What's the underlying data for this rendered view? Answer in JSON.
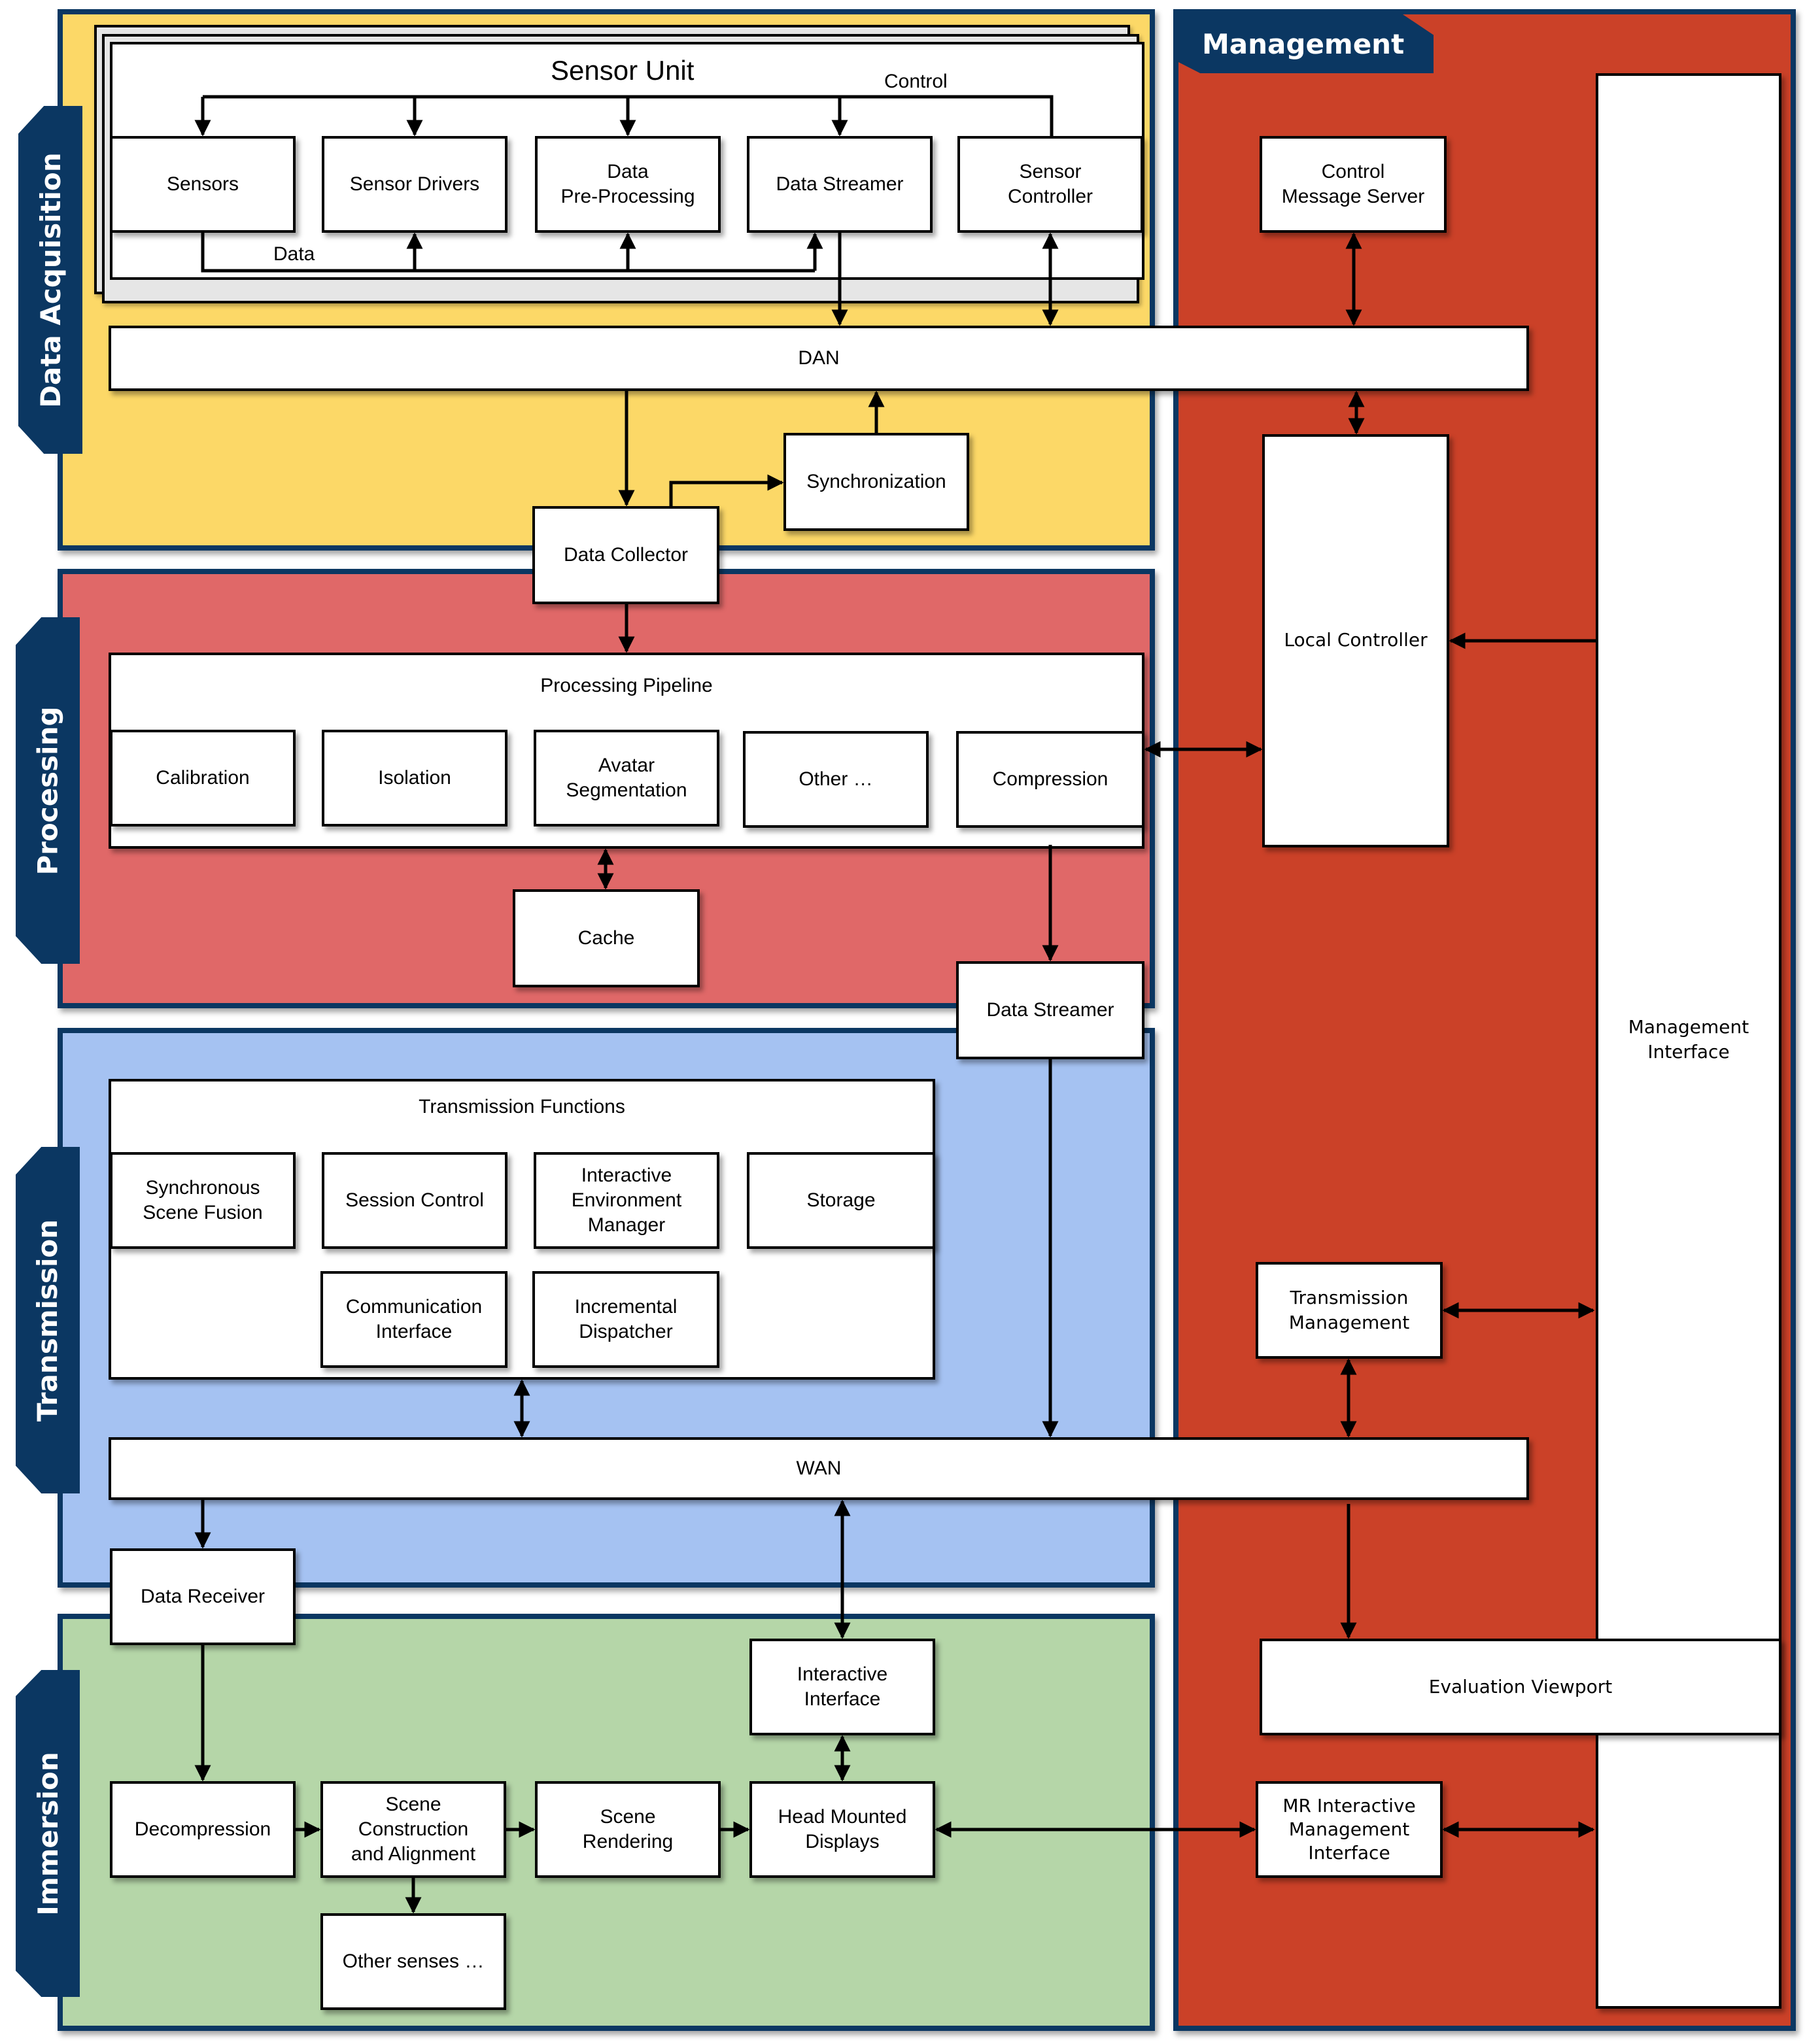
{
  "colors": {
    "acquisition": "#fcd867",
    "processing": "#e06868",
    "transmission": "#a5c2f2",
    "immersion": "#b5d6a8",
    "management": "#cb4128",
    "tab": "#0b3762"
  },
  "layers": {
    "acquisition": "Data Acquisition",
    "processing": "Processing",
    "transmission": "Transmission",
    "immersion": "Immersion",
    "management": "Management"
  },
  "acquisition": {
    "sensor_unit": "Sensor Unit",
    "control_label": "Control",
    "data_label": "Data",
    "sensors": "Sensors",
    "sensor_drivers": "Sensor Drivers",
    "pre_processing": "Data\nPre-Processing",
    "data_streamer": "Data Streamer",
    "sensor_controller": "Sensor\nController",
    "dan": "DAN",
    "synchronization": "Synchronization",
    "data_collector": "Data Collector"
  },
  "processing": {
    "pipeline": "Processing Pipeline",
    "calibration": "Calibration",
    "isolation": "Isolation",
    "avatar_segmentation": "Avatar\nSegmentation",
    "other": "Other …",
    "compression": "Compression",
    "cache": "Cache",
    "data_streamer": "Data Streamer"
  },
  "transmission": {
    "functions": "Transmission Functions",
    "sync_scene_fusion": "Synchronous\nScene Fusion",
    "session_control": "Session Control",
    "env_manager": "Interactive\nEnvironment\nManager",
    "storage": "Storage",
    "comm_interface": "Communication\nInterface",
    "incremental_dispatcher": "Incremental\nDispatcher",
    "wan": "WAN",
    "data_receiver": "Data Receiver"
  },
  "immersion": {
    "decompression": "Decompression",
    "scene_construction": "Scene\nConstruction\nand Alignment",
    "scene_rendering": "Scene\nRendering",
    "hmd": "Head Mounted\nDisplays",
    "interactive_interface": "Interactive\nInterface",
    "other_senses": "Other senses …"
  },
  "management": {
    "control_message_server": "Control\nMessage Server",
    "local_controller": "Local Controller",
    "management_interface": "Management\nInterface",
    "transmission_management": "Transmission\nManagement",
    "evaluation_viewport": "Evaluation Viewport",
    "mr_interactive": "MR Interactive\nManagement\nInterface"
  }
}
